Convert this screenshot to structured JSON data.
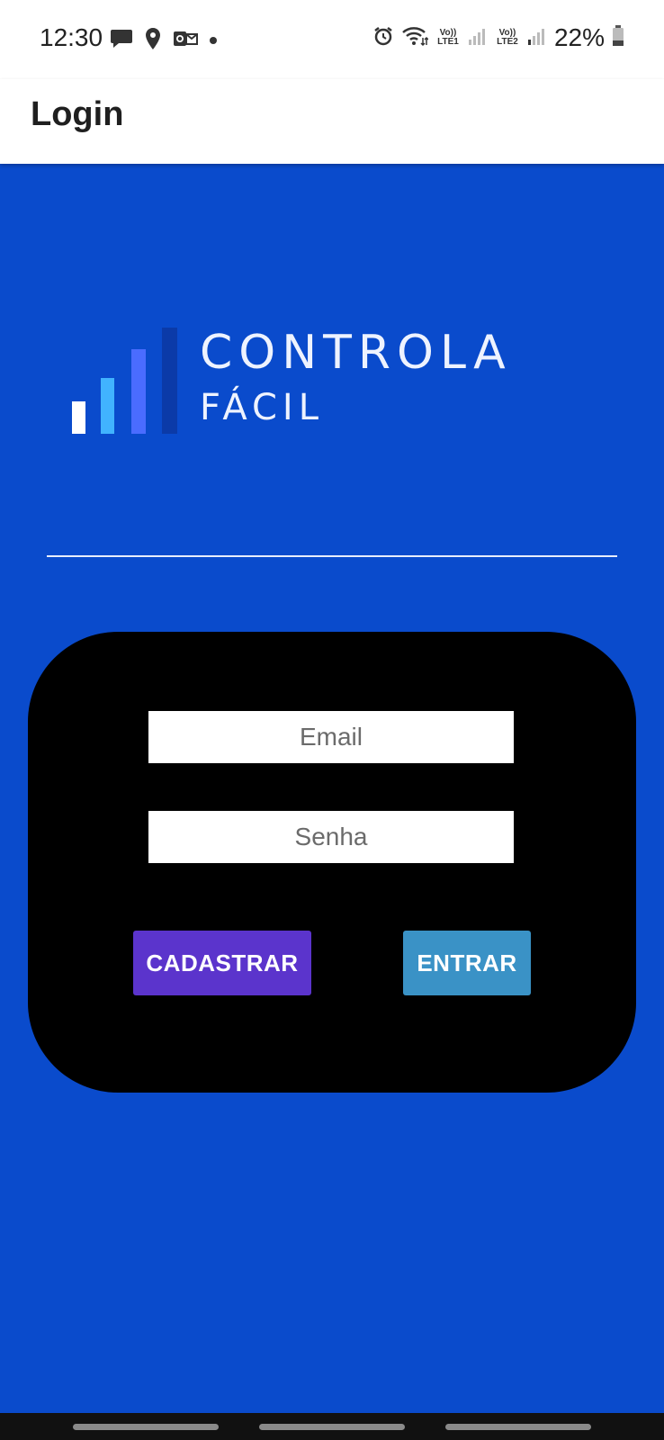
{
  "status_bar": {
    "time": "12:30",
    "left_icons": [
      "chat-bubble-icon",
      "location-pin-icon",
      "outlook-icon",
      "dot-icon"
    ],
    "right_icons": [
      "alarm-icon",
      "wifi-icon",
      "signal-sim1-icon",
      "signal-sim2-icon",
      "battery-icon"
    ],
    "sim1_label": "Vo)) LTE1",
    "sim2_label": "Vo)) LTE2",
    "battery": "22%"
  },
  "app_bar": {
    "title": "Login"
  },
  "logo": {
    "line1": "CONTROLA",
    "line2": "FÁCIL",
    "bar_colors": [
      "#ffffff",
      "#41b3ff",
      "#4a6cff",
      "#0b3aa8"
    ]
  },
  "form": {
    "email_placeholder": "Email",
    "password_placeholder": "Senha",
    "register_label": "CADASTRAR",
    "login_label": "ENTRAR"
  },
  "colors": {
    "background": "#0a4bcc",
    "card": "#000000",
    "register_button": "#5b34cc",
    "login_button": "#3a92c6"
  }
}
